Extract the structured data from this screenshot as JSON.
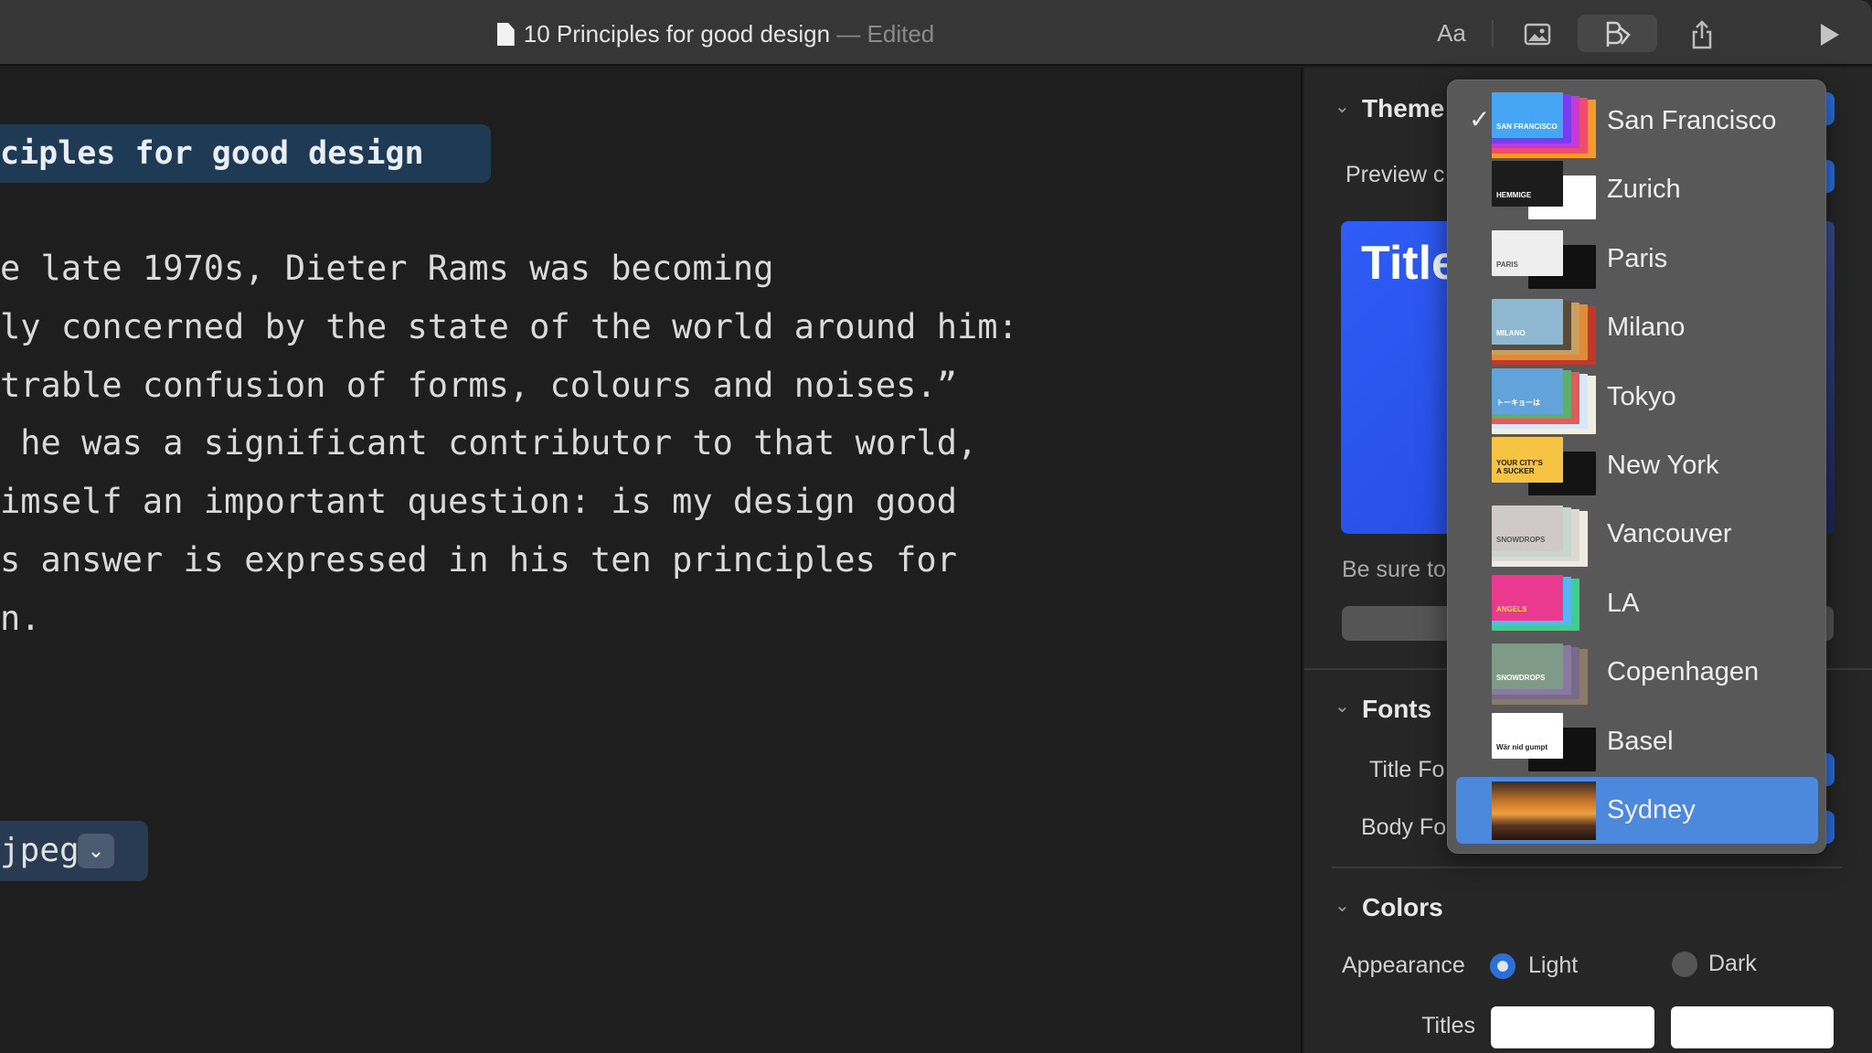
{
  "window": {
    "doc_title": "10 Principles for good design",
    "separator": "—",
    "status": "Edited"
  },
  "toolbar": {
    "icons": [
      "text-format-icon",
      "media-icon",
      "format-icon",
      "share-icon",
      "play-icon"
    ],
    "text_format_label": "Aa"
  },
  "editor": {
    "heading": "ciples for good design",
    "lines": [
      "e late 1970s, Dieter Rams was becoming",
      "ly concerned by the state of the world around him:",
      "trable confusion of forms, colours and noises.”",
      " he was a significant contributor to that world,",
      "imself an important question: is my design good",
      "s answer is expressed in his ten principles for",
      "n."
    ],
    "attachment": "jpeg"
  },
  "panel": {
    "theme": {
      "header": "Theme",
      "preview_label": "Preview c",
      "preview_title": "Title",
      "note": "Be sure to"
    },
    "fonts": {
      "header": "Fonts",
      "title_font": "Title Fo",
      "body_font": "Body Fo"
    },
    "colors": {
      "header": "Colors",
      "appearance": "Appearance",
      "light": "Light",
      "dark": "Dark",
      "titles": "Titles",
      "appearance_selected": "Light"
    }
  },
  "theme_menu": {
    "checked": "San Francisco",
    "highlighted": "Sydney",
    "items": [
      {
        "label": "San Francisco",
        "colors": [
          "#f39a2a",
          "#f04d6a",
          "#c83ad8",
          "#7b3cf0",
          "#46a6f5"
        ],
        "thumb_text": "SAN FRANCISCO",
        "text_color": "#ffffff"
      },
      {
        "label": "Zurich",
        "colors": [
          "#ffffff",
          "#1c1c1c"
        ],
        "thumb_text": "HEMMIGE",
        "text_color": "#ffffff"
      },
      {
        "label": "Paris",
        "colors": [
          "#111111",
          "#eeeeee"
        ],
        "thumb_text": "PARIS",
        "text_color": "#555555"
      },
      {
        "label": "Milano",
        "colors": [
          "#c0392b",
          "#e08a3a",
          "#c8a060",
          "#5a4a3a",
          "#8fb8d0"
        ],
        "thumb_text": "MILANO",
        "text_color": "#ffffff"
      },
      {
        "label": "Tokyo",
        "colors": [
          "#f3efe0",
          "#d8e8f6",
          "#e35a5a",
          "#5fae6a",
          "#62a3dc"
        ],
        "thumb_text": "トーキョーは",
        "text_color": "#ffffff"
      },
      {
        "label": "New York",
        "colors": [
          "#141414",
          "#f6c343"
        ],
        "thumb_text": "YOUR CITY'S\nA SUCKER",
        "text_color": "#1a1a1a"
      },
      {
        "label": "Vancouver",
        "colors": [
          "#eeeae4",
          "#dcd9cf",
          "#c9d6cf",
          "#cfcac8"
        ],
        "thumb_text": "SNOWDROPS",
        "text_color": "#555555"
      },
      {
        "label": "LA",
        "colors": [
          "#3ccf8e",
          "#56b6f5",
          "#e93a8f"
        ],
        "thumb_text": "ANGELS",
        "text_color": "#f6e03a"
      },
      {
        "label": "Copenhagen",
        "colors": [
          "#8a7a6a",
          "#7a6a8a",
          "#8a7aa0",
          "#7f9a86"
        ],
        "thumb_text": "SNOWDROPS",
        "text_color": "#ffffff"
      },
      {
        "label": "Basel",
        "colors": [
          "#111111",
          "#ffffff"
        ],
        "thumb_text": "Wär nid gumpt",
        "text_color": "#222222"
      },
      {
        "label": "Sydney",
        "colors": [
          "#e2892e",
          "#2a1a12"
        ],
        "thumb_text": "",
        "text_color": "#ffffff"
      }
    ]
  },
  "accent_colors": {
    "menu_highlight": "#4c89dc",
    "radio_selected": "#2d6fd8",
    "heading_bg": "#1f3a54"
  }
}
